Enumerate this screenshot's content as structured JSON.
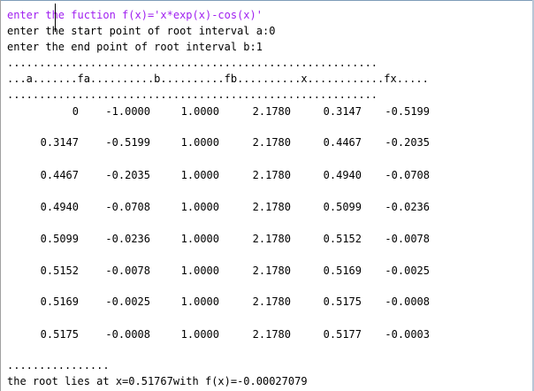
{
  "console": {
    "prompt_function": "enter the fuction f(x)='x*exp(x)-cos(x)'",
    "prompt_a": "enter the start point of root interval a:0",
    "prompt_b": "enter the end point of root interval b:1",
    "dots_line": "..........................................................",
    "header_line": "...a.......fa..........b..........fb..........x............fx.....",
    "dots_line_2": "..........................................................",
    "rows": [
      [
        "0",
        "-1.0000",
        "1.0000",
        "2.1780",
        "0.3147",
        "-0.5199"
      ],
      [
        "0.3147",
        "-0.5199",
        "1.0000",
        "2.1780",
        "0.4467",
        "-0.2035"
      ],
      [
        "0.4467",
        "-0.2035",
        "1.0000",
        "2.1780",
        "0.4940",
        "-0.0708"
      ],
      [
        "0.4940",
        "-0.0708",
        "1.0000",
        "2.1780",
        "0.5099",
        "-0.0236"
      ],
      [
        "0.5099",
        "-0.0236",
        "1.0000",
        "2.1780",
        "0.5152",
        "-0.0078"
      ],
      [
        "0.5152",
        "-0.0078",
        "1.0000",
        "2.1780",
        "0.5169",
        "-0.0025"
      ],
      [
        "0.5169",
        "-0.0025",
        "1.0000",
        "2.1780",
        "0.5175",
        "-0.0008"
      ],
      [
        "0.5175",
        "-0.0008",
        "1.0000",
        "2.1780",
        "0.5177",
        "-0.0003"
      ]
    ],
    "trailing_dots": "................",
    "result": "the root lies at x=0.51767with f(x)=-0.00027079"
  },
  "colors": {
    "input_text": "#a020f0",
    "output_text": "#000000",
    "background": "#ffffff"
  }
}
